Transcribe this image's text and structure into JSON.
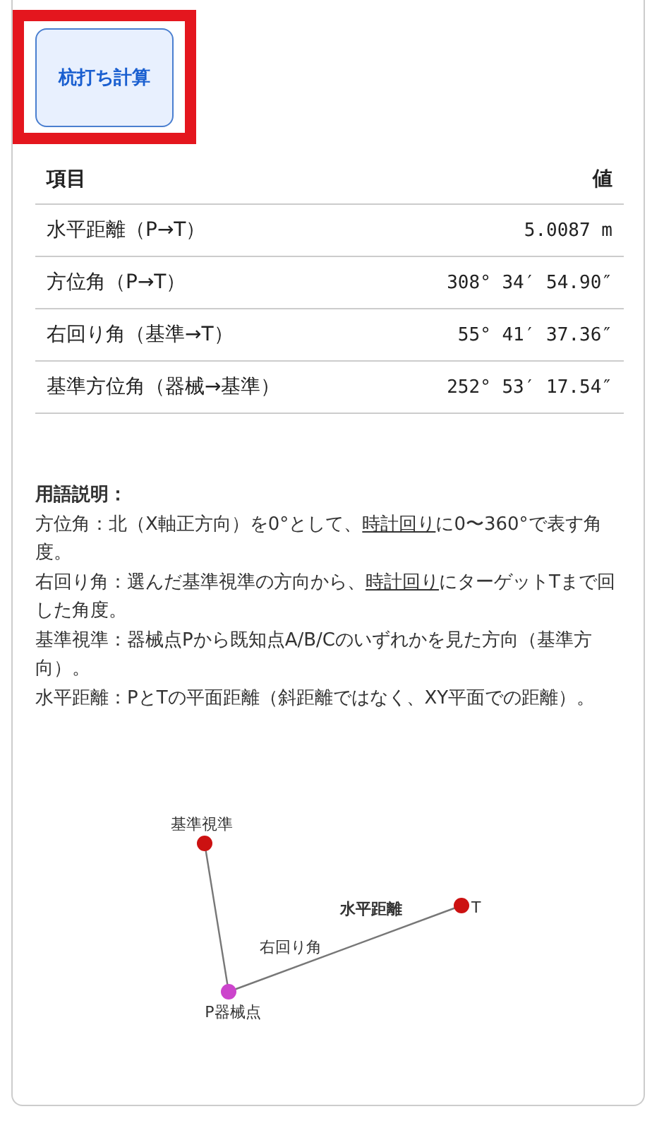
{
  "action_button": {
    "label": "杭打ち計算",
    "highlighted": true
  },
  "table": {
    "columns": [
      "項目",
      "値"
    ],
    "rows": [
      {
        "item": "水平距離（P→T）",
        "value": "5.0087 m"
      },
      {
        "item": "方位角（P→T）",
        "value": "308° 34′ 54.90″"
      },
      {
        "item": "右回り角（基準→T）",
        "value": "55° 41′ 37.36″"
      },
      {
        "item": "基準方位角（器械→基準）",
        "value": "252° 53′ 17.54″"
      }
    ]
  },
  "glossary": {
    "title": "用語説明：",
    "entries": [
      {
        "parts": [
          {
            "text": "方位角：北（X軸正方向）を0°として、",
            "underline": false
          },
          {
            "text": "時計回り",
            "underline": true
          },
          {
            "text": "に0〜360°で表す角度。",
            "underline": false
          }
        ]
      },
      {
        "parts": [
          {
            "text": "右回り角：選んだ基準視準の方向から、",
            "underline": false
          },
          {
            "text": "時計回り",
            "underline": true
          },
          {
            "text": "にターゲットTまで回した角度。",
            "underline": false
          }
        ]
      },
      {
        "parts": [
          {
            "text": "基準視準：器械点Pから既知点A/B/Cのいずれかを見た方向（基準方向）。",
            "underline": false
          }
        ]
      },
      {
        "parts": [
          {
            "text": "水平距離：PとTの平面距離（斜距離ではなく、XY平面での距離）。",
            "underline": false
          }
        ]
      }
    ]
  },
  "diagram": {
    "nodes": [
      {
        "label": "基準視準",
        "color": "#cc1111"
      },
      {
        "label": "P器械点",
        "color": "#cc44cc"
      },
      {
        "label": "T",
        "color": "#cc1111"
      }
    ],
    "distance_label": "水平距離",
    "angle_label": "右回り角"
  }
}
